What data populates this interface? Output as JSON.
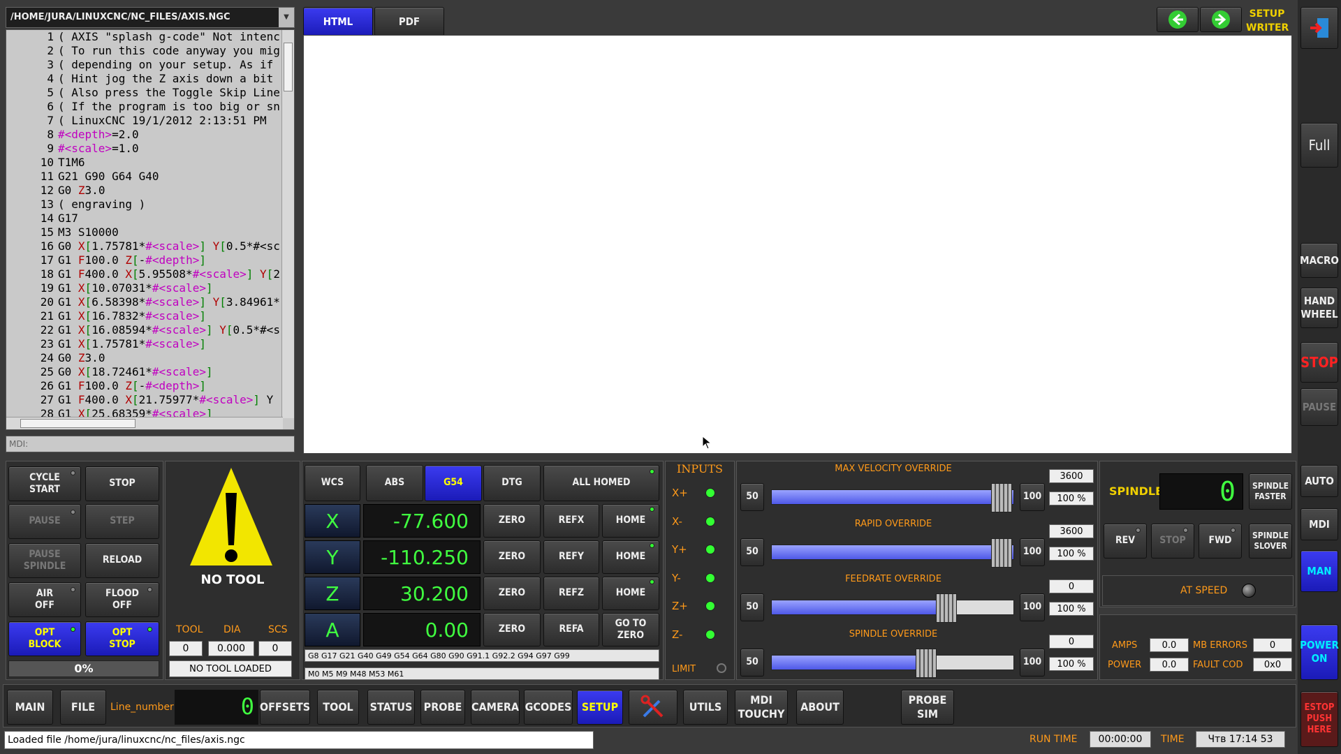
{
  "file_path": "/HOME/JURA/LINUXCNC/NC_FILES/AXIS.NGC",
  "code_lines": [
    "( AXIS \"splash g-code\" Not intenc",
    "( To run this code anyway you mig",
    "( depending on your setup. As if",
    "( Hint jog the Z axis down a bit",
    "( Also press the Toggle Skip Line",
    "( If the program is too big or sn",
    "( LinuxCNC 19/1/2012 2:13:51 PM",
    "#<depth>=2.0",
    "#<scale>=1.0",
    "T1M6",
    "G21 G90 G64 G40",
    "G0 Z3.0",
    "( engraving )",
    "G17",
    "M3 S10000",
    "G0 X[1.75781*#<scale>] Y[0.5*#<sc",
    "G1 F100.0 Z[-#<depth>]",
    "G1 F400.0 X[5.95508*#<scale>] Y[2",
    "G1 X[10.07031*#<scale>]",
    "G1 X[6.58398*#<scale>] Y[3.84961*",
    "G1 X[16.7832*#<scale>]",
    "G1 X[16.08594*#<scale>] Y[0.5*#<s",
    "G1 X[1.75781*#<scale>]",
    "G0 Z3.0",
    "G0 X[18.72461*#<scale>]",
    "G1 F100.0 Z[-#<depth>]",
    "G1 F400.0 X[21.75977*#<scale>] Y",
    "G1 X[25.68359*#<scale>]"
  ],
  "mdi_label": "MDI:",
  "tabs": {
    "html": "HTML",
    "pdf": "PDF"
  },
  "setup_writer": "SETUP\nWRITER",
  "right_bar": {
    "full": "Full",
    "macro": "MACRO",
    "hand_wheel": "HAND\nWHEEL",
    "stop": "STOP",
    "pause": "PAUSE",
    "auto": "AUTO",
    "mdi": "MDI",
    "man": "MAN",
    "power_on": "POWER\nON",
    "estop": "ESTOP\nPUSH\nHERE"
  },
  "controls": {
    "cycle_start": "CYCLE\nSTART",
    "stop": "STOP",
    "pause": "PAUSE",
    "step": "STEP",
    "pause_spindle": "PAUSE\nSPINDLE",
    "reload": "RELOAD",
    "air_off": "AIR\nOFF",
    "flood_off": "FLOOD\nOFF",
    "opt_block": "OPT\nBLOCK",
    "opt_stop": "OPT\nSTOP",
    "progress": "0%"
  },
  "tool": {
    "warning": "NO TOOL",
    "tool_lbl": "TOOL",
    "dia_lbl": "DIA",
    "scs_lbl": "SCS",
    "tool": "0",
    "dia": "0.000",
    "scs": "0",
    "status": "NO TOOL LOADED"
  },
  "dro": {
    "wcs": "WCS",
    "abs": "ABS",
    "g54": "G54",
    "dtg": "DTG",
    "all_homed": "ALL HOMED",
    "axes": [
      {
        "name": "X",
        "value": "-77.600",
        "ref": "REFX",
        "home": "HOME"
      },
      {
        "name": "Y",
        "value": "-110.250",
        "ref": "REFY",
        "home": "HOME"
      },
      {
        "name": "Z",
        "value": "30.200",
        "ref": "REFZ",
        "home": "HOME"
      },
      {
        "name": "A",
        "value": "0.00",
        "ref": "REFA",
        "home": "GO TO\nZERO"
      }
    ],
    "zero": "ZERO",
    "gcodes": "G8 G17 G21 G40 G49 G54 G64 G80 G90 G91.1 G92.2 G94 G97 G99",
    "mcodes": "M0 M5 M9 M48 M53 M61"
  },
  "inputs": {
    "title": "INPUTS",
    "items": [
      "X+",
      "X-",
      "Y+",
      "Y-",
      "Z+",
      "Z-"
    ],
    "limit": "LIMIT"
  },
  "overrides": [
    {
      "title": "MAX VELOCITY OVERRIDE",
      "min": "50",
      "max": "100",
      "value": "3600",
      "pct": "100 %",
      "level": 1.0
    },
    {
      "title": "RAPID OVERRIDE",
      "min": "50",
      "max": "100",
      "value": "3600",
      "pct": "100 %",
      "level": 1.0
    },
    {
      "title": "FEEDRATE OVERRIDE",
      "min": "50",
      "max": "100",
      "value": "0",
      "pct": "100 %",
      "level": 0.75
    },
    {
      "title": "SPINDLE OVERRIDE",
      "min": "50",
      "max": "100",
      "value": "0",
      "pct": "100 %",
      "level": 0.66
    }
  ],
  "spindle": {
    "title": "SPINDLE",
    "speed": "0",
    "faster": "SPINDLE\nFASTER",
    "slower": "SPINDLE\nSLOVER",
    "rev": "REV",
    "stop": "STOP",
    "fwd": "FWD",
    "at_speed": "AT SPEED",
    "amps_lbl": "AMPS",
    "amps": "0.0",
    "mb_lbl": "MB ERRORS",
    "mb": "0",
    "power_lbl": "POWER",
    "power": "0.0",
    "fault_lbl": "FAULT COD",
    "fault": "0x0"
  },
  "bottom": {
    "main": "MAIN",
    "file": "FILE",
    "line_number": "Line_number",
    "line_value": "0",
    "offsets": "OFFSETS",
    "tool": "TOOL",
    "status": "STATUS",
    "probe": "PROBE",
    "camera": "CAMERA",
    "gcodes": "GCODES",
    "setup": "SETUP",
    "utils": "UTILS",
    "mdi_touchy": "MDI\nTOUCHY",
    "about": "ABOUT",
    "probe_sim": "PROBE\nSIM"
  },
  "status_bar": {
    "message": "Loaded file /home/jura/linuxcnc/nc_files/axis.ngc",
    "run_time_lbl": "RUN TIME",
    "run_time": "00:00:00",
    "time_lbl": "TIME",
    "time": "Чтв 17:14 53"
  }
}
